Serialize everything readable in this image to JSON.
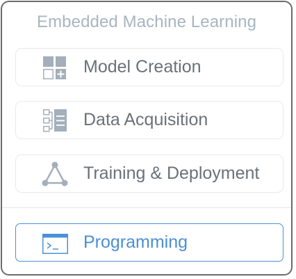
{
  "panel": {
    "title": "Embedded Machine Learning"
  },
  "menu": {
    "items": [
      {
        "label": "Model Creation",
        "icon": "model-grid-icon"
      },
      {
        "label": "Data Acquisition",
        "icon": "data-list-icon"
      },
      {
        "label": "Training & Deployment",
        "icon": "triangle-network-icon"
      }
    ],
    "footer_item": {
      "label": "Programming",
      "icon": "terminal-icon",
      "selected": true
    }
  },
  "colors": {
    "title": "#a7b6c0",
    "icon": "#a3afba",
    "label": "#6b7177",
    "accent": "#4a90d9",
    "border": "#6b6b6b"
  }
}
